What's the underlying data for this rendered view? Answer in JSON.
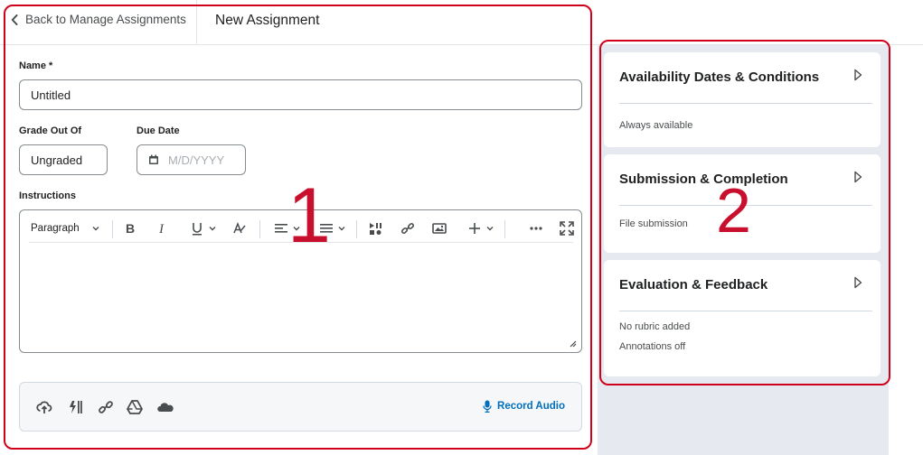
{
  "header": {
    "back_label": "Back to Manage Assignments",
    "title": "New Assignment"
  },
  "form": {
    "name": {
      "label": "Name *",
      "value": "Untitled"
    },
    "grade": {
      "label": "Grade Out Of",
      "value": "Ungraded"
    },
    "due_date": {
      "label": "Due Date",
      "placeholder": "M/D/YYYY"
    },
    "instructions": {
      "label": "Instructions",
      "paragraph_select": "Paragraph",
      "toolbar_icons": [
        "bold-icon",
        "italic-icon",
        "underline-icon",
        "format-strike-icon",
        "align-icon",
        "list-icon",
        "insert-stuff-icon",
        "link-icon",
        "image-icon",
        "insert-plus-icon",
        "more-icon",
        "fullscreen-icon"
      ]
    },
    "attachments": {
      "icons": [
        "upload-icon",
        "attach-quicklink-icon",
        "link-icon",
        "google-drive-icon",
        "onedrive-icon"
      ],
      "record_audio": "Record Audio"
    }
  },
  "side_panel": {
    "cards": [
      {
        "title": "Availability Dates & Conditions",
        "lines": [
          "Always available"
        ]
      },
      {
        "title": "Submission & Completion",
        "lines": [
          "File submission"
        ]
      },
      {
        "title": "Evaluation & Feedback",
        "lines": [
          "No rubric added",
          "Annotations off"
        ]
      }
    ]
  },
  "annotations": {
    "marker_1": "1",
    "marker_2": "2",
    "color": "#d0021b"
  },
  "colors": {
    "link": "#006fbf",
    "panel_bg": "#e6eaf0",
    "border": "#868c8f"
  }
}
